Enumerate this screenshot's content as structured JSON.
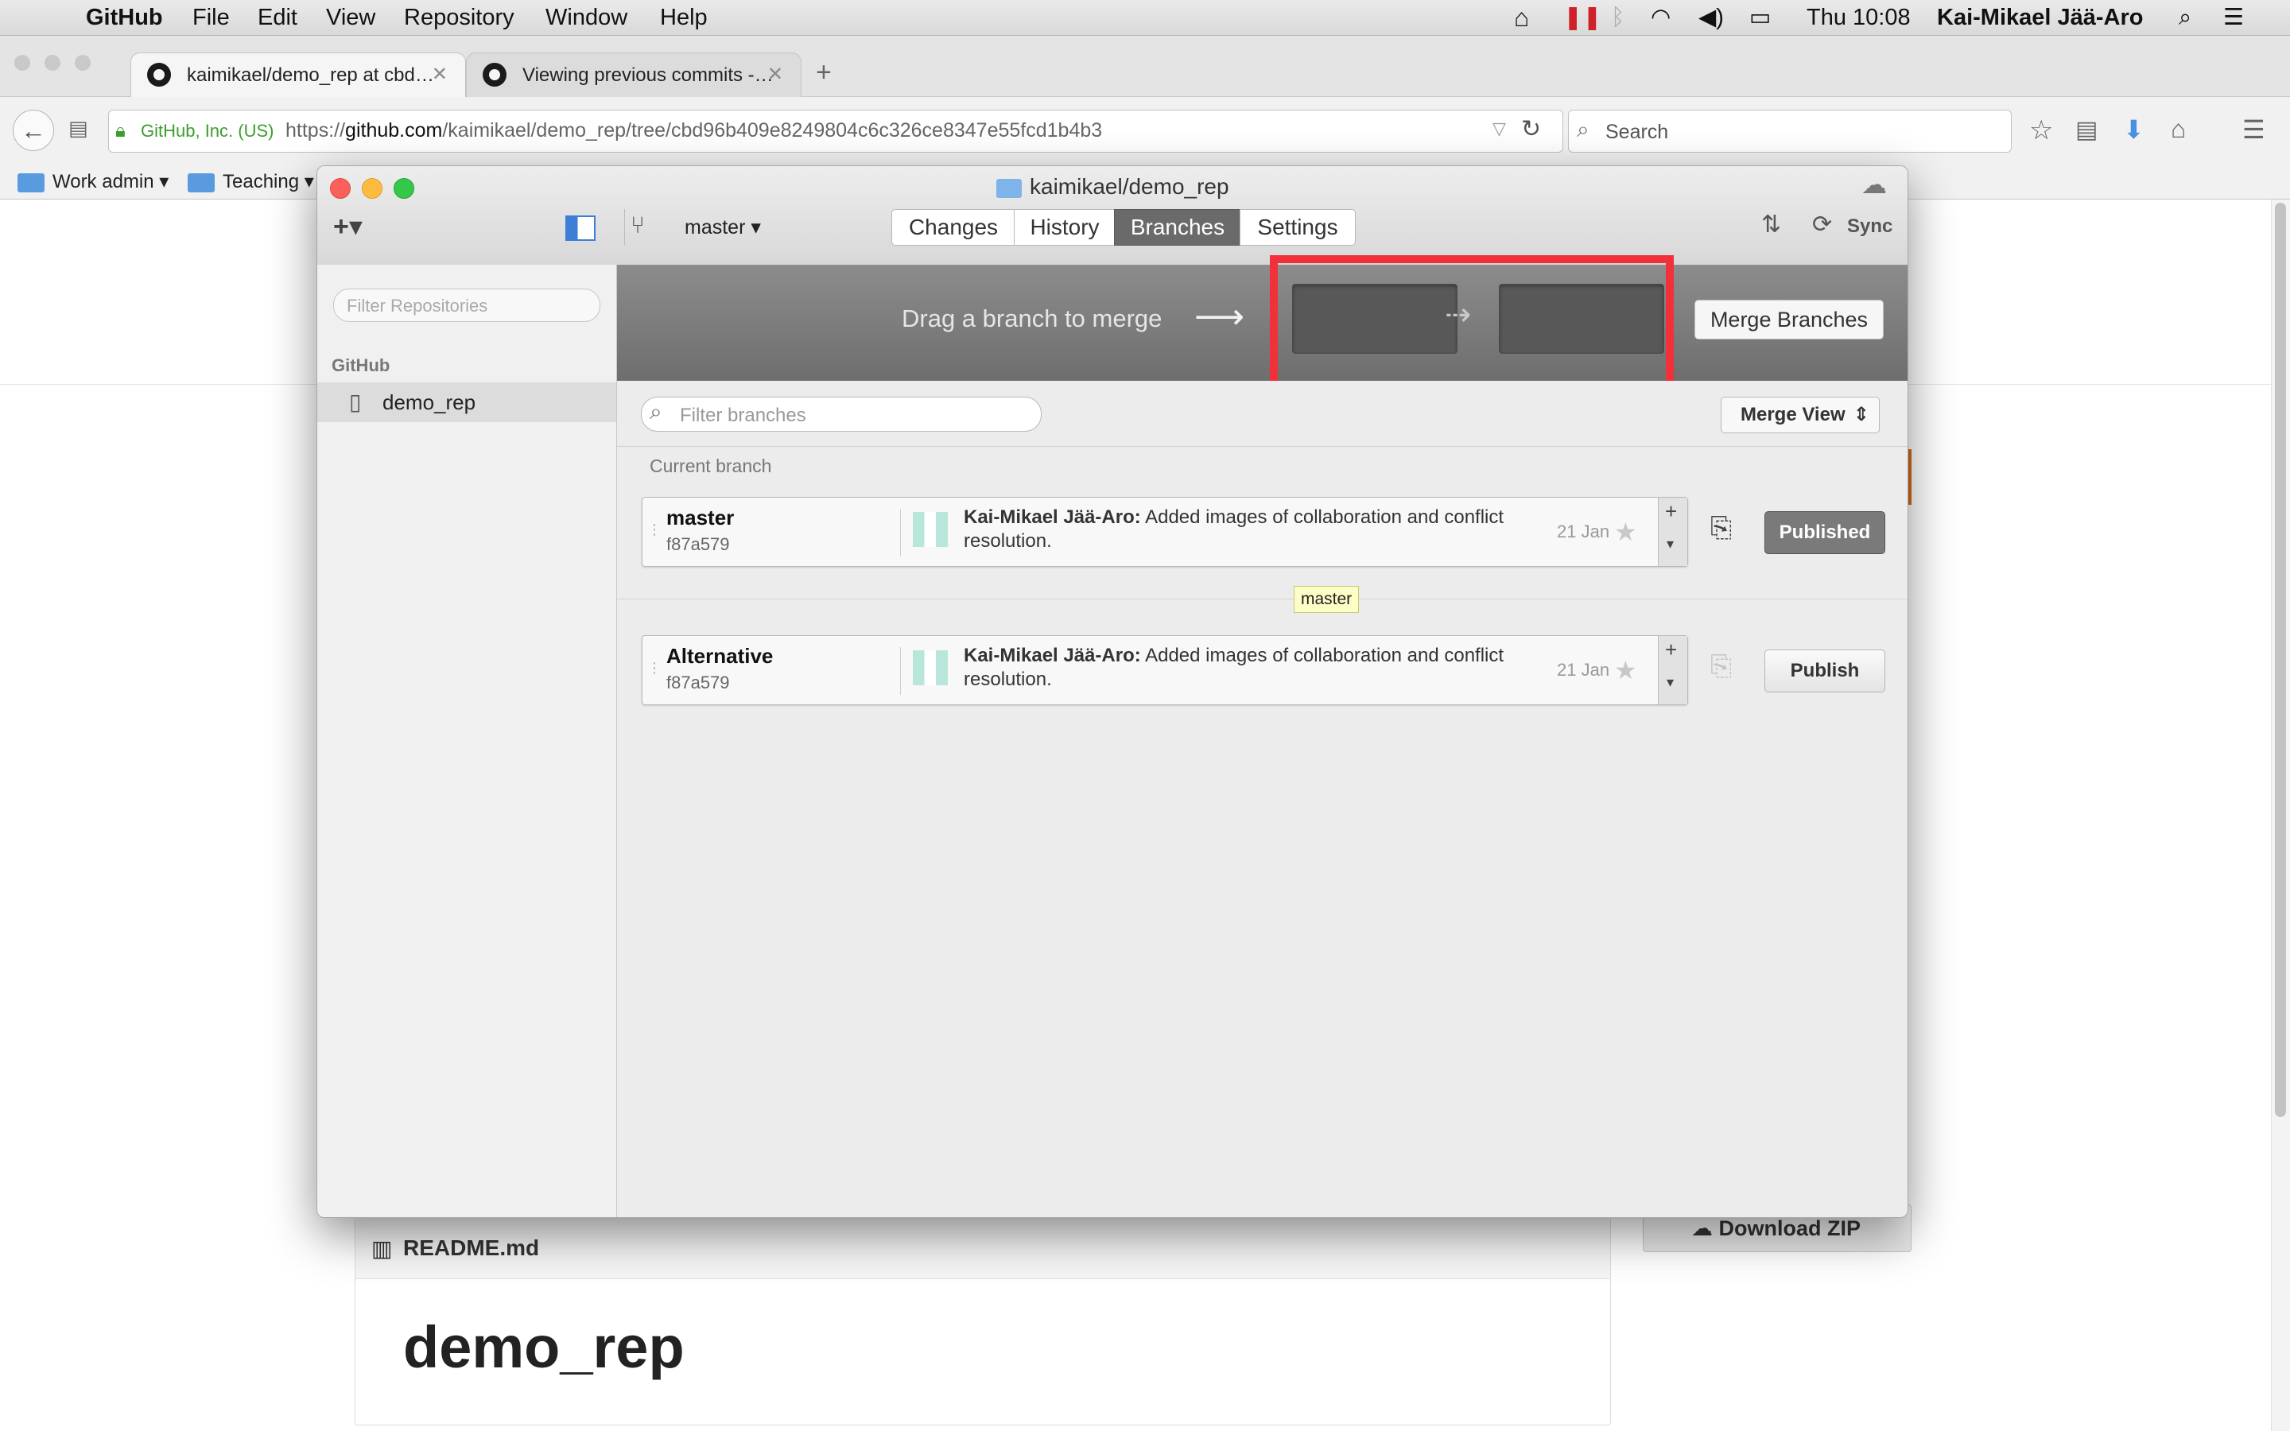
{
  "menubar": {
    "app_name": "GitHub",
    "items": [
      "File",
      "Edit",
      "View",
      "Repository",
      "Window",
      "Help"
    ],
    "clock": "Thu 10:08",
    "user": "Kai-Mikael Jää-Aro"
  },
  "browser": {
    "tabs": [
      {
        "label": "kaimikael/demo_rep at cbd…"
      },
      {
        "label": "Viewing previous commits -…"
      }
    ],
    "identity": "GitHub, Inc. (US)",
    "url_prefix": "https://",
    "url_host": "github.com",
    "url_path": "/kaimikael/demo_rep/tree/cbd96b409e8249804c6c326ce8347e55fcd1b4b3",
    "search_placeholder": "Search",
    "bookmarks": [
      "Work admin",
      "Teaching"
    ]
  },
  "page_behind": {
    "readme_label": "README.md",
    "heading": "demo_rep",
    "download_zip": "Download ZIP"
  },
  "app": {
    "window_title": "kaimikael/demo_rep",
    "current_branch_selector": "master",
    "tabs": [
      "Changes",
      "History",
      "Branches",
      "Settings"
    ],
    "active_tab": "Branches",
    "sync_label": "Sync",
    "sidebar": {
      "filter_placeholder": "Filter Repositories",
      "section": "GitHub",
      "repos": [
        "demo_rep"
      ]
    },
    "merge": {
      "hint": "Drag a branch to merge",
      "button": "Merge Branches"
    },
    "branch_filter_placeholder": "Filter branches",
    "merge_view_label": "Merge View",
    "current_branch_label": "Current branch",
    "tooltip": "master",
    "branches": [
      {
        "name": "master",
        "sha": "f87a579",
        "author": "Kai-Mikael Jää-Aro:",
        "message": "Added images of collaboration and conflict resolution.",
        "date": "21 Jan",
        "publish_label": "Published"
      },
      {
        "name": "Alternative",
        "sha": "f87a579",
        "author": "Kai-Mikael Jää-Aro:",
        "message": "Added images of collaboration and conflict resolution.",
        "date": "21 Jan",
        "publish_label": "Publish"
      }
    ]
  }
}
